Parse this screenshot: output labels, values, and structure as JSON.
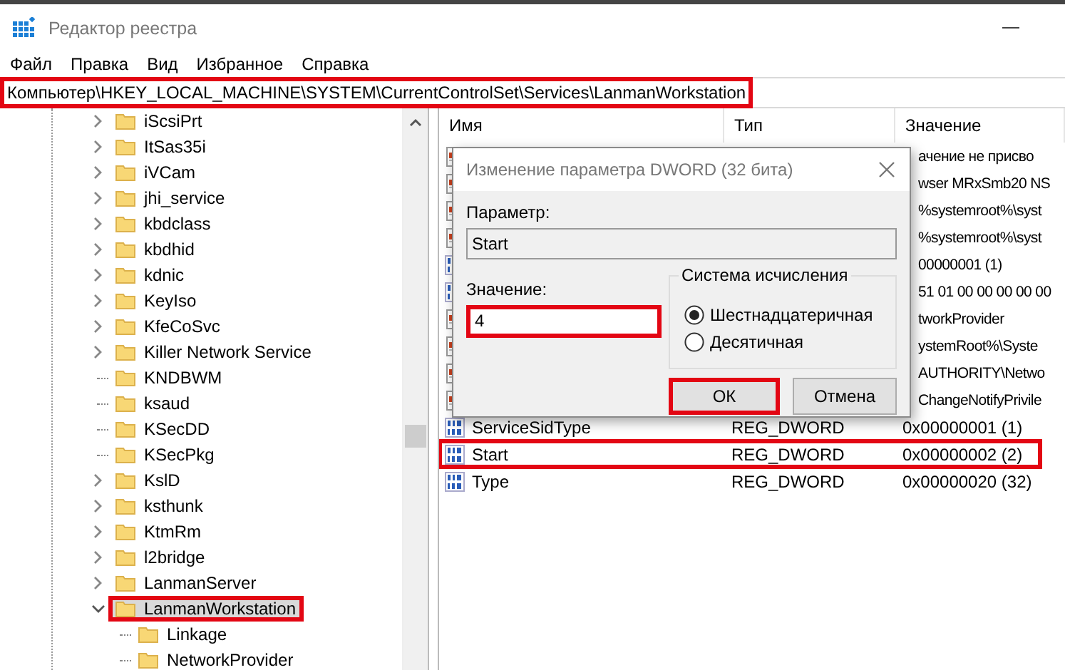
{
  "window": {
    "title": "Редактор реестра"
  },
  "menu": [
    "Файл",
    "Правка",
    "Вид",
    "Избранное",
    "Справка"
  ],
  "address": {
    "value": "Компьютер\\HKEY_LOCAL_MACHINE\\SYSTEM\\CurrentControlSet\\Services\\LanmanWorkstation",
    "highlighted": true
  },
  "tree": [
    {
      "label": "iScsiPrt",
      "expandable": true,
      "expanded": false,
      "selected": false,
      "highlighted": false
    },
    {
      "label": "ItSas35i",
      "expandable": true,
      "expanded": false,
      "selected": false,
      "highlighted": false
    },
    {
      "label": "iVCam",
      "expandable": true,
      "expanded": false,
      "selected": false,
      "highlighted": false
    },
    {
      "label": "jhi_service",
      "expandable": true,
      "expanded": false,
      "selected": false,
      "highlighted": false
    },
    {
      "label": "kbdclass",
      "expandable": true,
      "expanded": false,
      "selected": false,
      "highlighted": false
    },
    {
      "label": "kbdhid",
      "expandable": true,
      "expanded": false,
      "selected": false,
      "highlighted": false
    },
    {
      "label": "kdnic",
      "expandable": true,
      "expanded": false,
      "selected": false,
      "highlighted": false
    },
    {
      "label": "KeyIso",
      "expandable": true,
      "expanded": false,
      "selected": false,
      "highlighted": false
    },
    {
      "label": "KfeCoSvc",
      "expandable": true,
      "expanded": false,
      "selected": false,
      "highlighted": false
    },
    {
      "label": "Killer Network Service",
      "expandable": true,
      "expanded": false,
      "selected": false,
      "highlighted": false
    },
    {
      "label": "KNDBWM",
      "expandable": false,
      "selected": false,
      "highlighted": false
    },
    {
      "label": "ksaud",
      "expandable": false,
      "selected": false,
      "highlighted": false
    },
    {
      "label": "KSecDD",
      "expandable": false,
      "selected": false,
      "highlighted": false
    },
    {
      "label": "KSecPkg",
      "expandable": false,
      "selected": false,
      "highlighted": false
    },
    {
      "label": "KslD",
      "expandable": true,
      "expanded": false,
      "selected": false,
      "highlighted": false
    },
    {
      "label": "ksthunk",
      "expandable": true,
      "expanded": false,
      "selected": false,
      "highlighted": false
    },
    {
      "label": "KtmRm",
      "expandable": true,
      "expanded": false,
      "selected": false,
      "highlighted": false
    },
    {
      "label": "l2bridge",
      "expandable": true,
      "expanded": false,
      "selected": false,
      "highlighted": false
    },
    {
      "label": "LanmanServer",
      "expandable": true,
      "expanded": false,
      "selected": false,
      "highlighted": false
    },
    {
      "label": "LanmanWorkstation",
      "expandable": true,
      "expanded": true,
      "selected": true,
      "highlighted": true,
      "children": [
        {
          "label": "Linkage",
          "expandable": false,
          "selected": false,
          "highlighted": false
        },
        {
          "label": "NetworkProvider",
          "expandable": false,
          "selected": false,
          "highlighted": false
        }
      ]
    }
  ],
  "list": {
    "columns": [
      "Имя",
      "Тип",
      "Значение"
    ],
    "rows": [
      {
        "kind": "string",
        "value": "ачение не присво",
        "highlighted": false
      },
      {
        "kind": "string",
        "value": "wser MRxSmb20 NS",
        "highlighted": false
      },
      {
        "kind": "string",
        "value": "%systemroot%\\syst",
        "highlighted": false
      },
      {
        "kind": "string",
        "value": "%systemroot%\\syst",
        "highlighted": false
      },
      {
        "kind": "dword",
        "value": "00000001 (1)",
        "highlighted": false
      },
      {
        "kind": "dword",
        "value": "51 01 00 00 00 00 00",
        "highlighted": false
      },
      {
        "kind": "string",
        "value": "tworkProvider",
        "highlighted": false
      },
      {
        "kind": "string",
        "value": "ystemRoot%\\Syste",
        "highlighted": false
      },
      {
        "kind": "string",
        "value": "AUTHORITY\\Netwo",
        "highlighted": false
      },
      {
        "kind": "string",
        "value": "ChangeNotifyPrivile",
        "highlighted": false
      },
      {
        "kind": "dword",
        "name": "ServiceSidType",
        "type": "REG_DWORD",
        "value": "0x00000001 (1)",
        "highlighted": false
      },
      {
        "kind": "dword",
        "name": "Start",
        "type": "REG_DWORD",
        "value": "0x00000002 (2)",
        "highlighted": true
      },
      {
        "kind": "dword",
        "name": "Type",
        "type": "REG_DWORD",
        "value": "0x00000020 (32)",
        "highlighted": false
      }
    ]
  },
  "dialog": {
    "title": "Изменение параметра DWORD (32 бита)",
    "param_label": "Параметр:",
    "param_value": "Start",
    "value_label": "Значение:",
    "value": "4",
    "value_highlighted": true,
    "base_group": "Система исчисления",
    "bases": [
      {
        "label": "Шестнадцатеричная",
        "selected": true
      },
      {
        "label": "Десятичная",
        "selected": false
      }
    ],
    "buttons": [
      {
        "label": "ОК",
        "highlighted": true
      },
      {
        "label": "Отмена",
        "highlighted": false
      }
    ]
  }
}
